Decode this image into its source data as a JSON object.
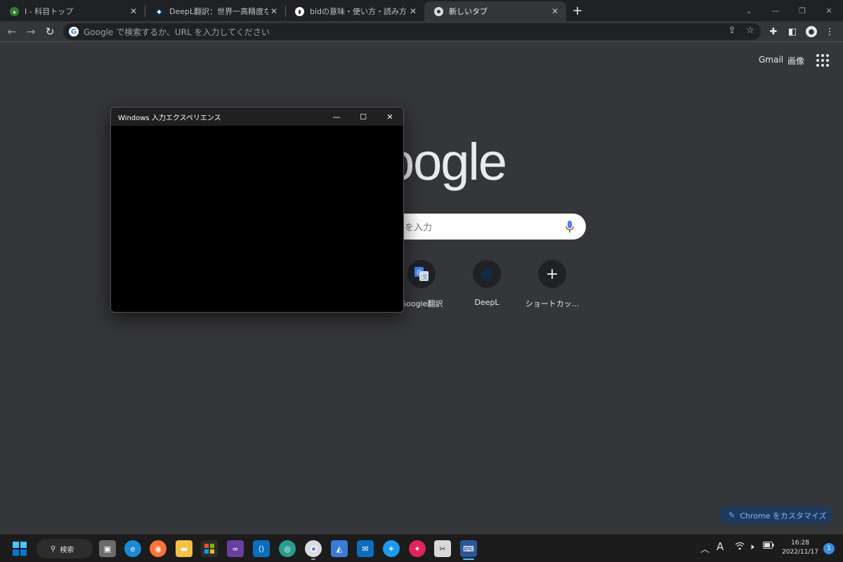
{
  "tabs": [
    {
      "label": "I - 科目トップ",
      "icon": "leaf-icon"
    },
    {
      "label": "DeepL翻訳：世界一高精度な翻訳",
      "icon": "deepl-icon"
    },
    {
      "label": "bidの意味・使い方・読み方 | 英辞郎",
      "icon": "eijiro-icon"
    },
    {
      "label": "新しいタブ",
      "icon": "chrome-icon"
    }
  ],
  "omnibox": {
    "placeholder": "Google で検索するか、URL を入力してください"
  },
  "ntp": {
    "gmail": "Gmail",
    "images": "画像",
    "logo_visible": "oogle",
    "search_placeholder_visible": "を入力",
    "shortcuts": [
      {
        "label": "Google翻訳",
        "icon": "google-translate-icon"
      },
      {
        "label": "DeepL",
        "icon": "deepl-icon"
      },
      {
        "label": "ショートカッ...",
        "icon": "plus-icon"
      }
    ],
    "customize": "Chrome をカスタマイズ"
  },
  "popup": {
    "title": "Windows 入力エクスペリエンス"
  },
  "taskbar": {
    "search": "検索",
    "ime": "A",
    "time": "16:28",
    "date": "2022/11/17",
    "notifications": "1"
  },
  "colors": {
    "page_bg": "#35363a",
    "tabstrip_bg": "#202124",
    "accent": "#8ab4f8",
    "taskbar_bg": "#1c1c1c"
  }
}
